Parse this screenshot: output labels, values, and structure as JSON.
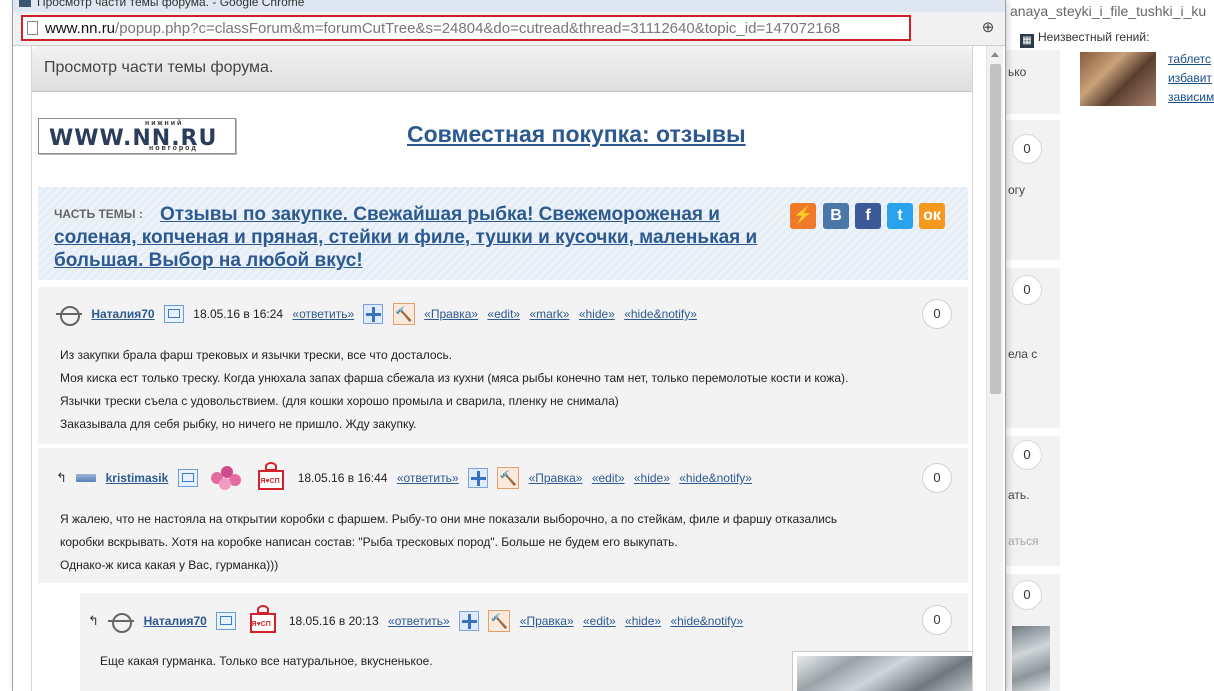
{
  "window": {
    "title": "Просмотр части темы форума. - Google Chrome"
  },
  "address_bar": {
    "host": "www.nn.ru",
    "path": "/popup.php?c=classForum&m=forumCutTree&s=24804&do=cutread&thread=31112640&topic_id=147072168"
  },
  "background_page": {
    "url_fragment": "anaya_steyki_i_file_tushki_i_ku",
    "bookmark_label": "Неизвестный гений:",
    "snippets": [
      "ько",
      "огу",
      "ела с",
      "ать.",
      "аться"
    ],
    "counts": [
      "0",
      "0",
      "0",
      "0"
    ],
    "links": [
      "таблетс",
      "избавит",
      "зависим"
    ]
  },
  "popup": {
    "header": "Просмотр части темы форума.",
    "logo": {
      "top": "нижний",
      "main": "WWW.NN.RU",
      "bottom": "новгород"
    },
    "forum_title": "Совместная покупка: отзывы",
    "topic_label": "ЧАСТЬ ТЕМЫ :",
    "topic_title": "Отзывы по закупке. Свежайшая рыбка! Свежемороженая и соленая, копченая и пряная, стейки и филе, тушки и кусочки, маленькая и большая. Выбор на любой вкус!",
    "social": [
      "⚡",
      "В",
      "f",
      "t",
      "ок"
    ]
  },
  "posts": [
    {
      "username": "Наталия70",
      "date": "18.05.16 в 16:24",
      "actions": [
        "«ответить»",
        "«Правка»",
        "«edit»",
        "«mark»",
        "«hide»",
        "«hide&notify»"
      ],
      "reply_count": "0",
      "lines": [
        "Из закупки брала фарш трековых и язычки трески, все что досталось.",
        "Моя киска ест только треску. Когда унюхала запах фарша сбежала из кухни (мяса рыбы конечно там нет, только перемолотые кости и кожа).",
        "Язычки трески съела с удовольствием. (для кошки хорошо промыла и сварила, пленку не снимала)",
        "Заказывала для себя рыбку, но ничего не пришло. Жду закупку."
      ]
    },
    {
      "username": "kristimasik",
      "date": "18.05.16 в 16:44",
      "actions": [
        "«ответить»",
        "«Правка»",
        "«edit»",
        "«hide»",
        "«hide&notify»"
      ],
      "reply_count": "0",
      "lines": [
        "Я жалею, что не настояла на открытии коробки с фаршем. Рыбу-то они мне показали выборочно, а по стейкам, филе и фаршу отказались",
        "коробки вскрывать. Хотя на коробке написан состав: \"Рыба тресковых пород\". Больше не будем его выкупать.",
        "Однако-ж киса какая у Вас, гурманка)))"
      ]
    },
    {
      "username": "Наталия70",
      "date": "18.05.16 в 20:13",
      "actions": [
        "«ответить»",
        "«Правка»",
        "«edit»",
        "«hide»",
        "«hide&notify»"
      ],
      "reply_count": "0",
      "lines": [
        "Еще какая гурманка. Только все натуральное, вкусненькое."
      ]
    }
  ],
  "badges": {
    "sp_gift": "Я♥СП"
  }
}
